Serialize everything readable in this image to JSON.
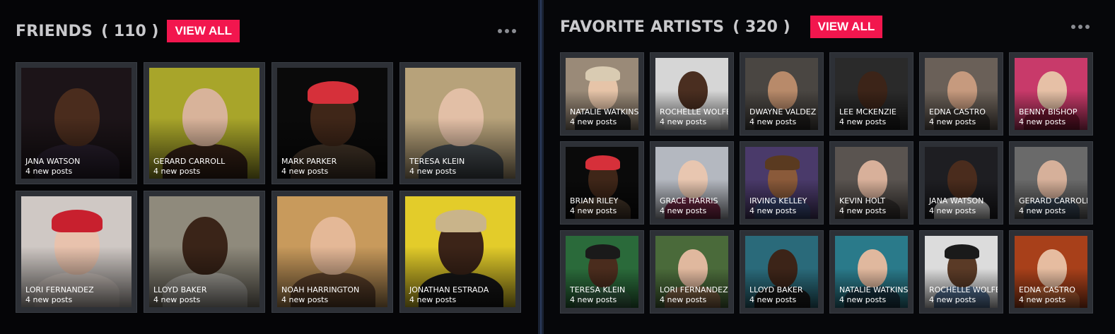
{
  "friends": {
    "title": "FRIENDS",
    "count": "( 110 )",
    "view_all": "VIEW ALL",
    "cards": [
      {
        "name": "JANA WATSON",
        "posts": "4 new posts",
        "bg": "#1c1418",
        "skin": "#4a2c1d",
        "hat": "",
        "cloth": "#2b2130"
      },
      {
        "name": "GERARD CARROLL",
        "posts": "4 new posts",
        "bg": "#a8a52a",
        "skin": "#d8b39a",
        "hat": "",
        "cloth": "#3a2418"
      },
      {
        "name": "MARK PARKER",
        "posts": "4 new posts",
        "bg": "#0a0a0a",
        "skin": "#3f2618",
        "hat": "#d6303a",
        "cloth": "#4a3a2c"
      },
      {
        "name": "TERESA KLEIN",
        "posts": "4 new posts",
        "bg": "#b7a27a",
        "skin": "#e2bfa6",
        "hat": "",
        "cloth": "#4b5257"
      },
      {
        "name": "LORI FERNANDEZ",
        "posts": "4 new posts",
        "bg": "#cfc8c4",
        "skin": "#e8c2ad",
        "hat": "#c8202e",
        "cloth": "#e0d6d0"
      },
      {
        "name": "LLOYD BAKER",
        "posts": "4 new posts",
        "bg": "#8f8a7c",
        "skin": "#3a2418",
        "hat": "",
        "cloth": "#b9b6ae"
      },
      {
        "name": "NOAH  HARRINGTON",
        "posts": "4 new posts",
        "bg": "#c89a5c",
        "skin": "#e4b897",
        "hat": "",
        "cloth": "#6a4a30"
      },
      {
        "name": "JONATHAN ESTRADA",
        "posts": "4 new posts",
        "bg": "#e3cc2a",
        "skin": "#3c2418",
        "hat": "#c9b48a",
        "cloth": "#1a1a1a"
      }
    ]
  },
  "artists": {
    "title": "FAVORITE ARTISTS",
    "count": "( 320 )",
    "view_all": "VIEW ALL",
    "cards": [
      {
        "name": "NATALIE WATKINS",
        "posts": "4 new posts",
        "bg": "#9a8a78",
        "skin": "#e6c4a8",
        "hat": "#d9cbb2",
        "cloth": "#2a2a2a"
      },
      {
        "name": "ROCHELLE WOLFE",
        "posts": "4 new posts",
        "bg": "#d6d6d6",
        "skin": "#4a2e20",
        "hat": "",
        "cloth": "#e8e8e8"
      },
      {
        "name": "DWAYNE VALDEZ",
        "posts": "4 new posts",
        "bg": "#4a4642",
        "skin": "#b88a6a",
        "hat": "",
        "cloth": "#2c2a28"
      },
      {
        "name": "LEE MCKENZIE",
        "posts": "4 new posts",
        "bg": "#2a2a2a",
        "skin": "#3c2418",
        "hat": "",
        "cloth": "#1e1e1e"
      },
      {
        "name": "EDNA CASTRO",
        "posts": "4 new posts",
        "bg": "#6a6058",
        "skin": "#c69a7e",
        "hat": "",
        "cloth": "#3a3430"
      },
      {
        "name": "BENNY BISHOP",
        "posts": "4 new posts",
        "bg": "#c83a6a",
        "skin": "#e6c0a6",
        "hat": "",
        "cloth": "#8a1a3a"
      },
      {
        "name": "BRIAN RILEY",
        "posts": "4 new posts",
        "bg": "#0a0a0a",
        "skin": "#3f2618",
        "hat": "#d6303a",
        "cloth": "#4a3a2c"
      },
      {
        "name": "GRACE HARRIS",
        "posts": "4 new posts",
        "bg": "#b4b8c0",
        "skin": "#e8c6b0",
        "hat": "",
        "cloth": "#7a2a4a"
      },
      {
        "name": "IRVING KELLEY",
        "posts": "4 new posts",
        "bg": "#4a3a6a",
        "skin": "#8a5a3a",
        "hat": "#5a3a20",
        "cloth": "#3a4a7a"
      },
      {
        "name": "KEVIN  HOLT",
        "posts": "4 new posts",
        "bg": "#5a5450",
        "skin": "#d8b09a",
        "hat": "",
        "cloth": "#3a3634"
      },
      {
        "name": "JANA WATSON",
        "posts": "4 new posts",
        "bg": "#1e1e22",
        "skin": "#4a2c1d",
        "hat": "",
        "cloth": "#d8d8d8"
      },
      {
        "name": "GERARD CARROLL",
        "posts": "4 new posts",
        "bg": "#6a6a6a",
        "skin": "#d6b09a",
        "hat": "",
        "cloth": "#3a4a5a"
      },
      {
        "name": "TERESA KLEIN",
        "posts": "4 new posts",
        "bg": "#2a6a3a",
        "skin": "#4a2c1d",
        "hat": "#1a1a1a",
        "cloth": "#3a6a4a"
      },
      {
        "name": "LORI FERNANDEZ",
        "posts": "4 new posts",
        "bg": "#4a6a3a",
        "skin": "#e0b89e",
        "hat": "",
        "cloth": "#8a6a4a"
      },
      {
        "name": "LLOYD BAKER",
        "posts": "4 new posts",
        "bg": "#2a6a7a",
        "skin": "#3c2418",
        "hat": "",
        "cloth": "#1a1a1a"
      },
      {
        "name": "NATALIE WATKINS",
        "posts": "4 new posts",
        "bg": "#2a7a8a",
        "skin": "#e0b89e",
        "hat": "",
        "cloth": "#1a3a4a"
      },
      {
        "name": "ROCHELLE WOLFE",
        "posts": "4 new posts",
        "bg": "#dcdcdc",
        "skin": "#5a3a26",
        "hat": "#1a1a1a",
        "cloth": "#5a7aa0"
      },
      {
        "name": "EDNA CASTRO",
        "posts": "4 new posts",
        "bg": "#a8401a",
        "skin": "#e6bca0",
        "hat": "",
        "cloth": "#c86a3a"
      }
    ]
  },
  "colors": {
    "accent": "#f2164e",
    "card_border": "#2d3036"
  }
}
